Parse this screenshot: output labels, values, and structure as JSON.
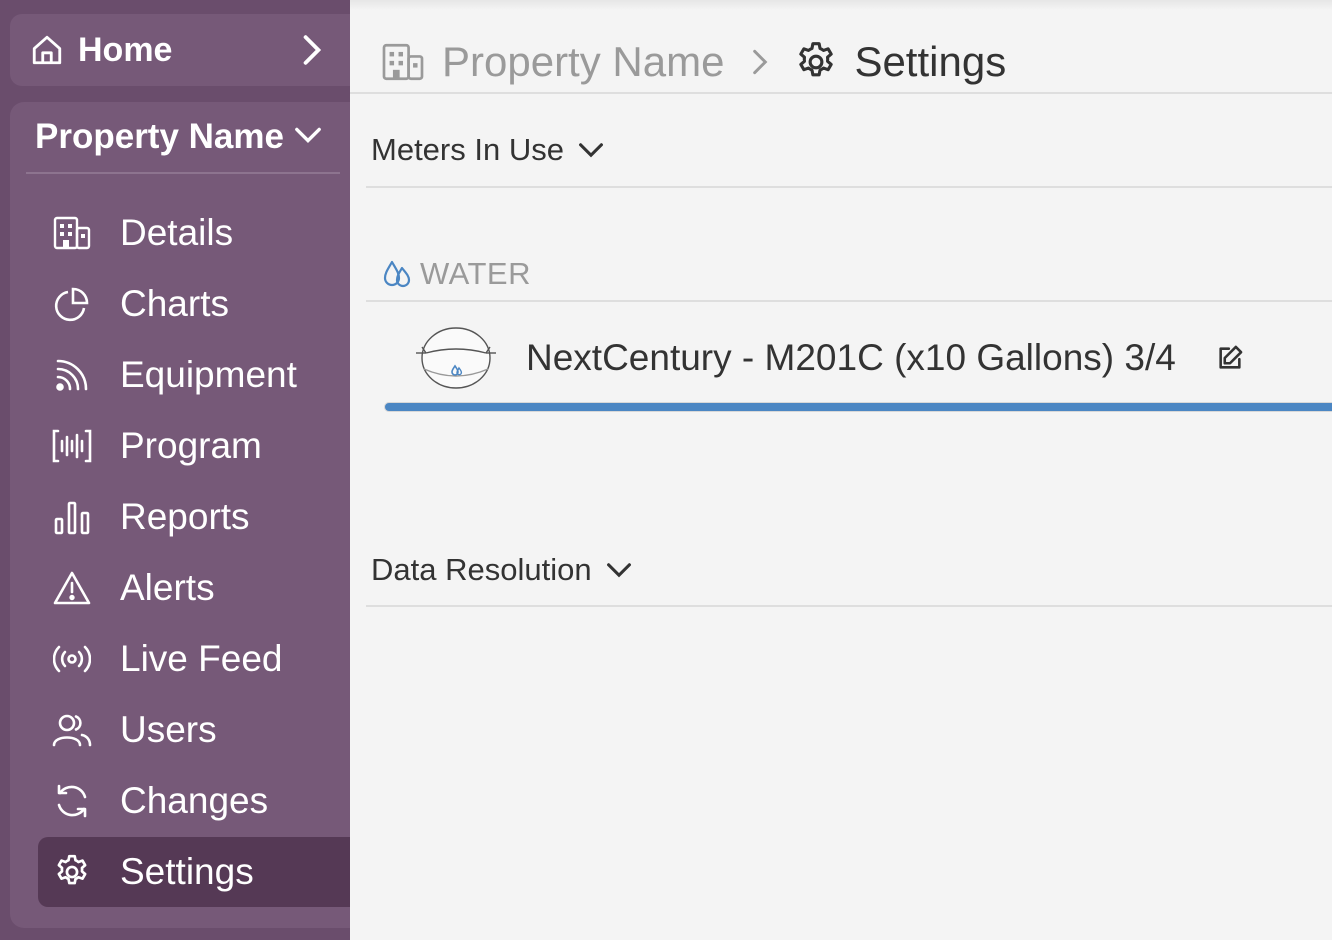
{
  "sidebar": {
    "home": {
      "label": "Home",
      "icon": "home-icon"
    },
    "property": {
      "label": "Property Name"
    },
    "items": [
      {
        "label": "Details",
        "icon": "building-icon"
      },
      {
        "label": "Charts",
        "icon": "pie-chart-icon"
      },
      {
        "label": "Equipment",
        "icon": "signal-icon"
      },
      {
        "label": "Program",
        "icon": "waveform-icon"
      },
      {
        "label": "Reports",
        "icon": "bar-chart-icon"
      },
      {
        "label": "Alerts",
        "icon": "warning-icon"
      },
      {
        "label": "Live Feed",
        "icon": "broadcast-icon"
      },
      {
        "label": "Users",
        "icon": "users-icon"
      },
      {
        "label": "Changes",
        "icon": "refresh-icon"
      },
      {
        "label": "Settings",
        "icon": "gear-icon",
        "active": true
      }
    ]
  },
  "breadcrumb": {
    "property": "Property Name",
    "current": "Settings"
  },
  "sections": {
    "meters": {
      "title": "Meters In Use"
    },
    "resolution": {
      "title": "Data Resolution"
    }
  },
  "water_group": {
    "label": "WATER",
    "meter": {
      "name": "NextCentury - M201C (x10 Gallons) 3/4",
      "icon": "water-meter-icon",
      "progress": 1.0
    }
  },
  "colors": {
    "sidebar_bg": "#6a4d6c",
    "card_bg": "#765978",
    "active_bg": "#553955",
    "accent_blue": "#4b86c3"
  }
}
